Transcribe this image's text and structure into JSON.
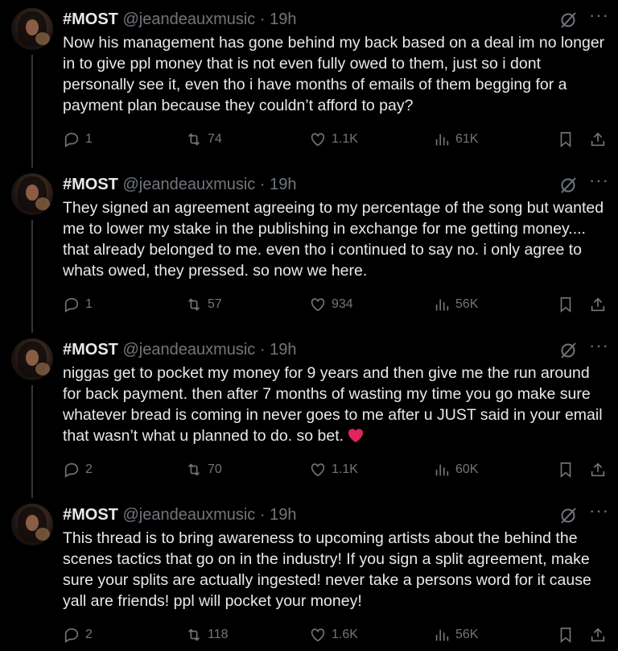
{
  "tweets": [
    {
      "name": "#MOST",
      "handle": "@jeandeauxmusic",
      "time": "· 19h",
      "text": "Now his management has gone behind my back based on a deal im no longer in to give ppl money that is not even fully owed to them, just so i dont personally see it, even tho i have months of emails of them begging for a payment plan because they couldn’t afford to pay?",
      "replies": "1",
      "reposts": "74",
      "likes": "1.1K",
      "views": "61K"
    },
    {
      "name": "#MOST",
      "handle": "@jeandeauxmusic",
      "time": "· 19h",
      "text": "They signed an agreement agreeing to my percentage of the song but wanted me to lower my stake in the publishing in exchange for me getting money.... that already belonged to me. even tho i continued to say no. i only agree to whats owed, they pressed. so now we here.",
      "replies": "1",
      "reposts": "57",
      "likes": "934",
      "views": "56K"
    },
    {
      "name": "#MOST",
      "handle": "@jeandeauxmusic",
      "time": "· 19h",
      "text": "niggas get to pocket my money for 9 years and then give me the run around for back payment. then after 7 months of wasting my time you go make sure whatever bread is coming in never goes to me after u JUST said in your email that wasn’t what u planned to do. so bet.",
      "replies": "2",
      "reposts": "70",
      "likes": "1.1K",
      "views": "60K"
    },
    {
      "name": "#MOST",
      "handle": "@jeandeauxmusic",
      "time": "· 19h",
      "text": "This thread is to bring awareness to upcoming artists about the behind the scenes tactics that go on in the industry! If you sign a split agreement, make sure your splits are actually ingested! never take a persons word for it cause yall are friends! ppl will pocket your money!",
      "replies": "2",
      "reposts": "118",
      "likes": "1.6K",
      "views": "56K"
    }
  ],
  "colors": {
    "background": "#000000",
    "text": "#e7e9ea",
    "muted": "#71767b",
    "heart": "#e0245e"
  },
  "icons": [
    "reply-icon",
    "repost-icon",
    "like-icon",
    "views-icon",
    "bookmark-icon",
    "share-icon",
    "grok-icon",
    "more-icon",
    "red-heart-emoji"
  ]
}
